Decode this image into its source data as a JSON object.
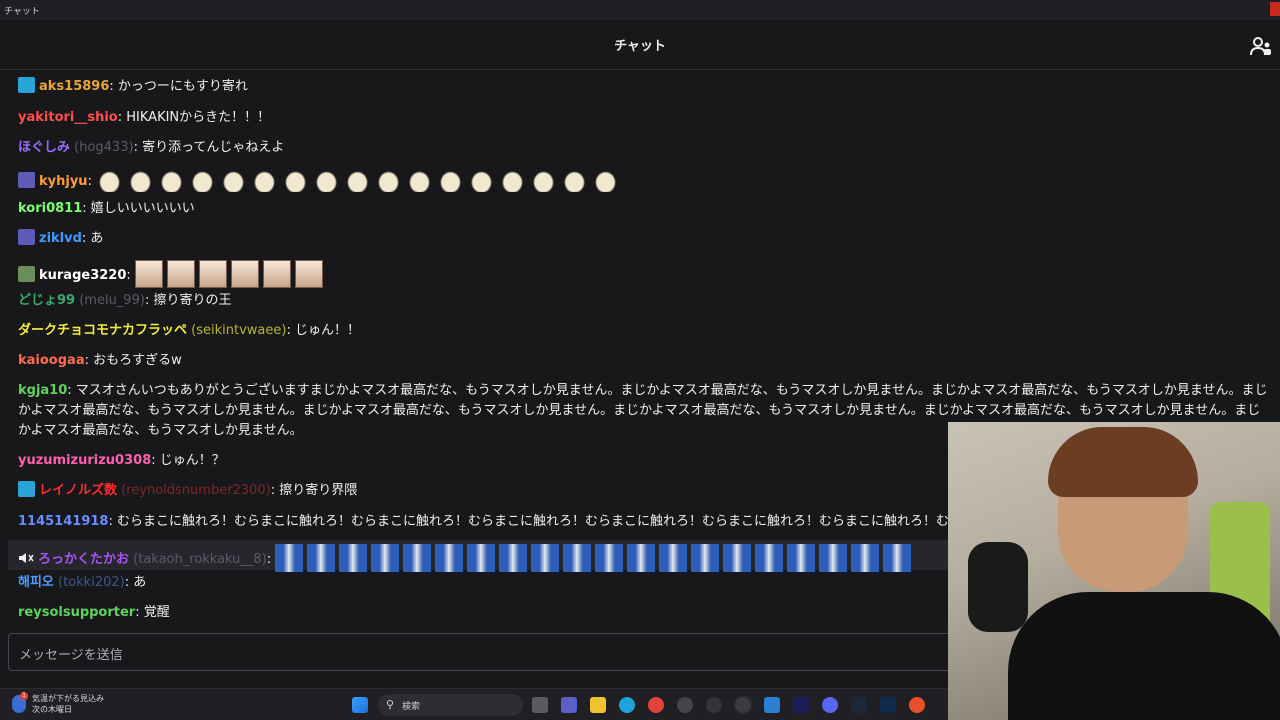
{
  "window": {
    "title": "チャット"
  },
  "header": {
    "title": "チャット"
  },
  "messages": [
    {
      "name": "aks15896",
      "sep": ": ",
      "text": "かっつーにもすり寄れ"
    },
    {
      "name": "yakitori__shio",
      "sep": ": ",
      "text": "HIKAKINからきた！！！"
    },
    {
      "name": "ほぐしみ",
      "login": " (hog433)",
      "sep": ": ",
      "text": "寄り添ってんじゃねえよ"
    },
    {
      "name": "kyhjyu",
      "sep": ":"
    },
    {
      "name": "kori0811",
      "sep": ": ",
      "text": "嬉しいいいいいい"
    },
    {
      "name": "ziklvd",
      "sep": ": ",
      "text": "あ"
    },
    {
      "name": "kurage3220",
      "sep": ":"
    },
    {
      "name": "どじょ99",
      "login": " (melu_99)",
      "sep": ": ",
      "text": "擦り寄りの王"
    },
    {
      "name": "ダークチョコモナカフラッペ",
      "login": " (seikintvwaee)",
      "sep": ": ",
      "text": "じゅん！！"
    },
    {
      "name": "kaioogaa",
      "sep": ": ",
      "text": "おもろすぎるw"
    },
    {
      "name": "kgja10",
      "sep": ": ",
      "text": "マスオさんいつもありがとうございますまじかよマスオ最高だな、もうマスオしか見ません。まじかよマスオ最高だな、もうマスオしか見ません。まじかよマスオ最高だな、もうマスオしか見ません。まじかよマスオ最高だな、もうマスオしか見ません。まじかよマスオ最高だな、もうマスオしか見ません。まじかよマスオ最高だな、もうマスオしか見ません。まじかよマスオ最高だな、もうマスオしか見ません。まじかよマスオ最高だな、もうマスオしか見ません。"
    },
    {
      "name": "yuzumizurizu0308",
      "sep": ": ",
      "text": "じゅん！？"
    },
    {
      "name": "レイノルズ数",
      "login": " (reynoldsnumber2300)",
      "sep": ": ",
      "text": "擦り寄り界隈"
    },
    {
      "name": "1145141918",
      "sep": ": ",
      "text": "むらまこに触れろ！むらまこに触れろ！むらまこに触れろ！むらまこに触れろ！むらまこに触れろ！むらまこに触れろ！むらまこに触れろ！むらま"
    },
    {
      "name": "ろっかくたかお",
      "login": " (takaoh_rokkaku__8)",
      "sep": ":"
    },
    {
      "name": "해피오",
      "login": " (tokki202)",
      "sep": ": ",
      "text": "あ"
    },
    {
      "name": "reysolsupporter",
      "sep": ": ",
      "text": "覚醒"
    }
  ],
  "colors": {
    "aks": "#e8a63a",
    "yakitori": "#ff4d4d",
    "hog": "#9a6cff",
    "kyhjyu": "#ff9b3d",
    "kori": "#7cff6b",
    "ziklvd": "#3d9bff",
    "kurage": "#ffffff",
    "doujo": "#3ea86a",
    "dark": "#f4ee3a",
    "kaioogaa": "#ff6b4d",
    "kgja": "#5fd35f",
    "yuzu": "#ff5fb0",
    "reynolds": "#ff2a2a",
    "num": "#6b8cff",
    "rokkaku": "#a855f7",
    "happy": "#4d9bff",
    "reysol": "#5fd35f"
  },
  "input": {
    "placeholder": "メッセージを送信"
  },
  "taskbar": {
    "weather_line1": "気温が下がる見込み",
    "weather_line2": "次の木曜日",
    "weather_badge": "1",
    "search_label": "検索"
  }
}
